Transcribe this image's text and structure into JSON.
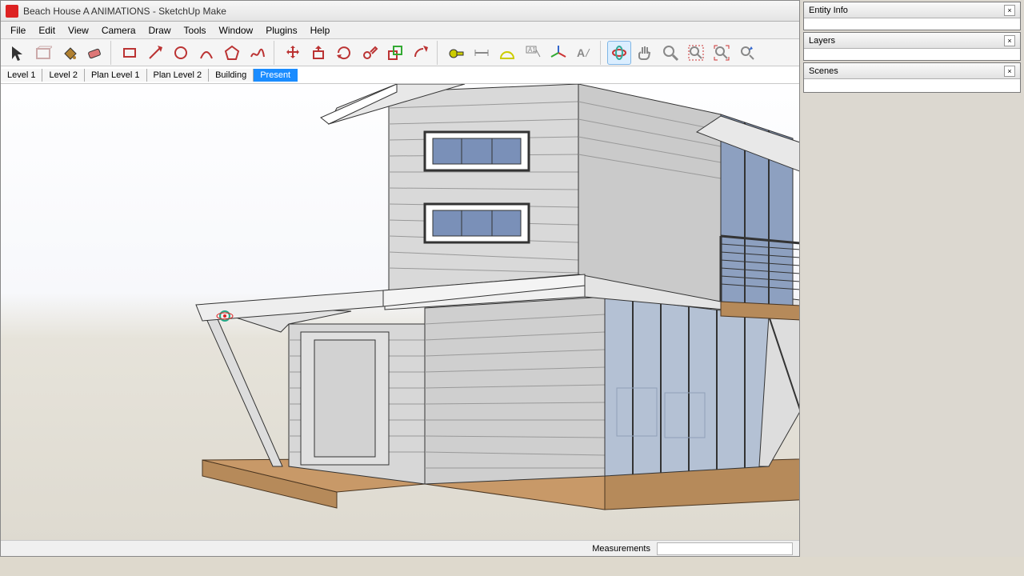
{
  "window": {
    "title": "Beach House A ANIMATIONS - SketchUp Make"
  },
  "menu": {
    "items": [
      "File",
      "Edit",
      "View",
      "Camera",
      "Draw",
      "Tools",
      "Window",
      "Plugins",
      "Help"
    ]
  },
  "toolbar": {
    "tools": [
      {
        "name": "select-icon",
        "color": "#333"
      },
      {
        "name": "make-component-icon",
        "color": "#caa"
      },
      {
        "name": "paint-bucket-icon",
        "color": "#b08030"
      },
      {
        "name": "eraser-icon",
        "color": "#d77"
      },
      {
        "sep": true
      },
      {
        "name": "rectangle-icon",
        "color": "#b33"
      },
      {
        "name": "line-icon",
        "color": "#b33"
      },
      {
        "name": "circle-icon",
        "color": "#b33"
      },
      {
        "name": "arc-icon",
        "color": "#b33"
      },
      {
        "name": "polygon-icon",
        "color": "#b33"
      },
      {
        "name": "freehand-icon",
        "color": "#b33"
      },
      {
        "sep": true
      },
      {
        "name": "move-icon",
        "color": "#b33"
      },
      {
        "name": "pushpull-icon",
        "color": "#b33"
      },
      {
        "name": "rotate-icon",
        "color": "#b33"
      },
      {
        "name": "followme-icon",
        "color": "#b33"
      },
      {
        "name": "scale-icon",
        "color": "#b33"
      },
      {
        "name": "offset-icon",
        "color": "#b33"
      },
      {
        "sep": true
      },
      {
        "name": "tape-icon",
        "color": "#cc0"
      },
      {
        "name": "dimension-icon",
        "color": "#888"
      },
      {
        "name": "protractor-icon",
        "color": "#cc0"
      },
      {
        "name": "text-icon",
        "color": "#888"
      },
      {
        "name": "axes-icon",
        "color": "#36c"
      },
      {
        "name": "3dtext-icon",
        "color": "#888"
      },
      {
        "sep": true
      },
      {
        "name": "orbit-icon",
        "color": "#3a9",
        "active": true
      },
      {
        "name": "pan-icon",
        "color": "#888"
      },
      {
        "name": "zoom-icon",
        "color": "#888"
      },
      {
        "name": "zoom-window-icon",
        "color": "#888"
      },
      {
        "name": "zoom-extents-icon",
        "color": "#888"
      },
      {
        "name": "previous-icon",
        "color": "#36c"
      }
    ]
  },
  "scenes": {
    "tabs": [
      {
        "label": "Level 1"
      },
      {
        "label": "Level 2"
      },
      {
        "label": "Plan Level 1"
      },
      {
        "label": "Plan Level 2"
      },
      {
        "label": "Building"
      },
      {
        "label": "Present",
        "active": true
      }
    ]
  },
  "panels": {
    "items": [
      {
        "title": "Entity Info"
      },
      {
        "title": "Layers"
      },
      {
        "title": "Scenes"
      }
    ]
  },
  "status": {
    "measurements_label": "Measurements"
  }
}
